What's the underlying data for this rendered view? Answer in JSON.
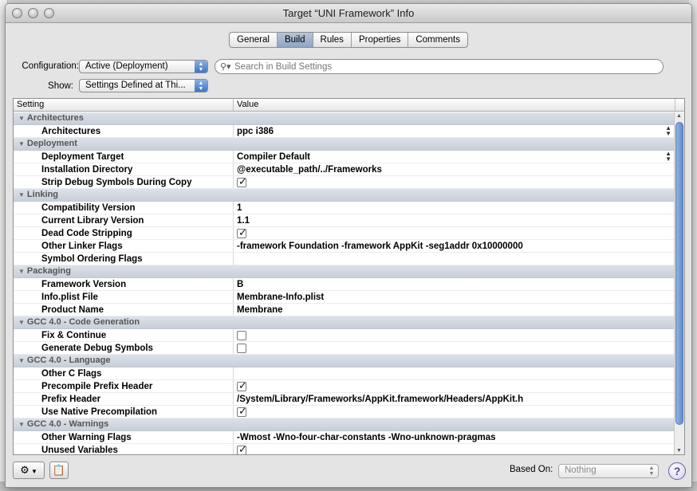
{
  "window": {
    "title": "Target “UNI Framework” Info"
  },
  "tabs": [
    {
      "label": "General"
    },
    {
      "label": "Build",
      "active": true
    },
    {
      "label": "Rules"
    },
    {
      "label": "Properties"
    },
    {
      "label": "Comments"
    }
  ],
  "configuration": {
    "label": "Configuration:",
    "value": "Active (Deployment)"
  },
  "show": {
    "label": "Show:",
    "value": "Settings Defined at Thi..."
  },
  "search": {
    "placeholder": "Search in Build Settings",
    "icon": "magnifier-icon"
  },
  "table": {
    "headers": {
      "setting": "Setting",
      "value": "Value"
    },
    "groups": [
      {
        "title": "Architectures",
        "rows": [
          {
            "key": "Architectures",
            "type": "text",
            "value": "ppc i386",
            "stepper": true
          }
        ]
      },
      {
        "title": "Deployment",
        "rows": [
          {
            "key": "Deployment Target",
            "type": "text",
            "value": "Compiler Default",
            "stepper": true
          },
          {
            "key": "Installation Directory",
            "type": "text",
            "value": "@executable_path/../Frameworks"
          },
          {
            "key": "Strip Debug Symbols During Copy",
            "type": "checkbox",
            "checked": true
          }
        ]
      },
      {
        "title": "Linking",
        "rows": [
          {
            "key": "Compatibility Version",
            "type": "text",
            "value": "1"
          },
          {
            "key": "Current Library Version",
            "type": "text",
            "value": "1.1"
          },
          {
            "key": "Dead Code Stripping",
            "type": "checkbox",
            "checked": true
          },
          {
            "key": "Other Linker Flags",
            "type": "text",
            "value": "-framework Foundation -framework AppKit -seg1addr 0x10000000"
          },
          {
            "key": "Symbol Ordering Flags",
            "type": "text",
            "value": ""
          }
        ]
      },
      {
        "title": "Packaging",
        "rows": [
          {
            "key": "Framework Version",
            "type": "text",
            "value": "B"
          },
          {
            "key": "Info.plist File",
            "type": "text",
            "value": "Membrane-Info.plist"
          },
          {
            "key": "Product Name",
            "type": "text",
            "value": "Membrane"
          }
        ]
      },
      {
        "title": "GCC 4.0 - Code Generation",
        "rows": [
          {
            "key": "Fix & Continue",
            "type": "checkbox",
            "checked": false
          },
          {
            "key": "Generate Debug Symbols",
            "type": "checkbox",
            "checked": false
          }
        ]
      },
      {
        "title": "GCC 4.0 - Language",
        "rows": [
          {
            "key": "Other C Flags",
            "type": "text",
            "value": ""
          },
          {
            "key": "Precompile Prefix Header",
            "type": "checkbox",
            "checked": true
          },
          {
            "key": "Prefix Header",
            "type": "text",
            "value": "/System/Library/Frameworks/AppKit.framework/Headers/AppKit.h"
          },
          {
            "key": "Use Native Precompilation",
            "type": "checkbox",
            "checked": true
          }
        ]
      },
      {
        "title": "GCC 4.0 - Warnings",
        "rows": [
          {
            "key": "Other Warning Flags",
            "type": "text",
            "value": "-Wmost -Wno-four-char-constants -Wno-unknown-pragmas"
          },
          {
            "key": "Unused Variables",
            "type": "checkbox",
            "checked": true
          }
        ]
      }
    ]
  },
  "bottom": {
    "gear_icon": "gear-icon",
    "clipboard_icon": "clipboard-icon",
    "based_on_label": "Based On:",
    "based_on_value": "Nothing",
    "help_label": "?"
  }
}
